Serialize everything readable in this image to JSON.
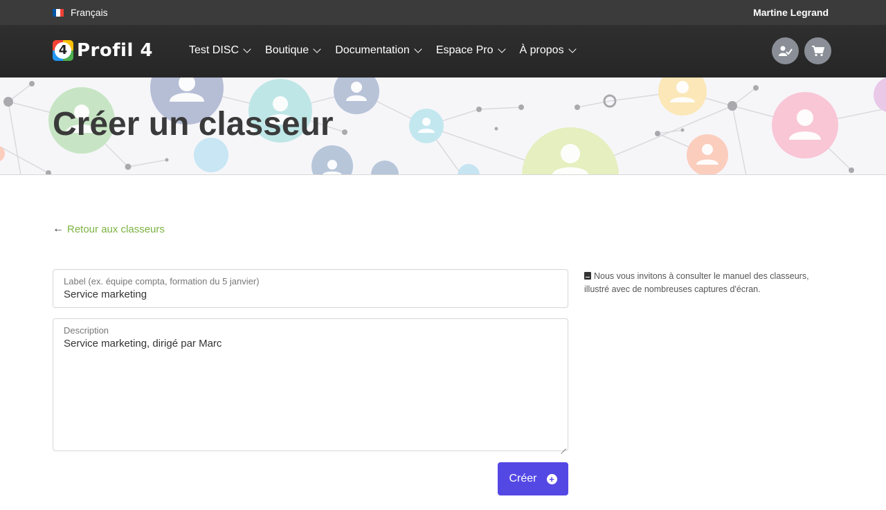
{
  "topbar": {
    "language": "Français",
    "user_name": "Martine Legrand"
  },
  "navbar": {
    "logo_number": "4",
    "brand": "Profil 4",
    "menu": [
      {
        "label": "Test DISC"
      },
      {
        "label": "Boutique"
      },
      {
        "label": "Documentation"
      },
      {
        "label": "Espace Pro"
      },
      {
        "label": "À propos"
      }
    ],
    "icons": [
      "user-check-icon",
      "cart-icon"
    ]
  },
  "hero": {
    "title": "Créer un classeur"
  },
  "back_link": {
    "label": "Retour aux classeurs"
  },
  "form": {
    "label_field": {
      "label": "Label (ex. équipe compta, formation du 5 janvier)",
      "value": "Service marketing"
    },
    "description_field": {
      "label": "Description",
      "value": "Service marketing, dirigé par Marc"
    },
    "submit_label": "Créer"
  },
  "side_note": {
    "text": "Nous vous invitons à consulter le manuel des classeurs, illustré avec de nombreuses captures d'écran."
  },
  "colors": {
    "accent": "#5448e5",
    "link": "#7cb342",
    "navbar": "#2b2b2b"
  }
}
